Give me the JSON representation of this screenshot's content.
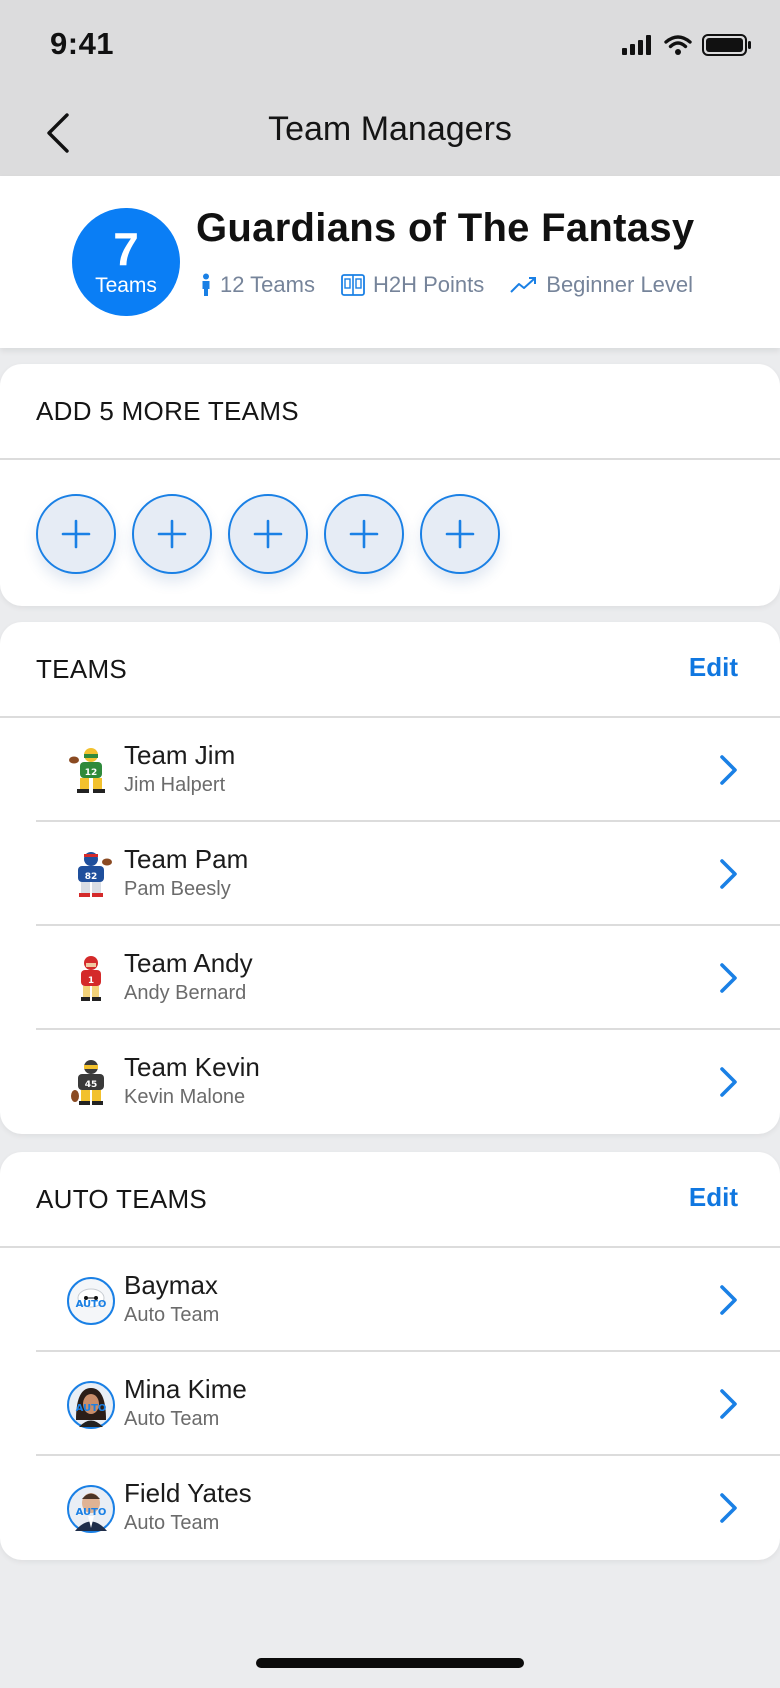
{
  "status_bar": {
    "time": "9:41",
    "icons": [
      "signal-icon",
      "wifi-icon",
      "battery-icon"
    ]
  },
  "nav": {
    "title": "Team Managers",
    "back_icon": "chevron-left-icon"
  },
  "league": {
    "team_count": "7",
    "team_count_label": "Teams",
    "name": "Guardians of The Fantasy",
    "meta": [
      {
        "icon": "person-icon",
        "label": "12 Teams"
      },
      {
        "icon": "scoreboard-icon",
        "label": "H2H Points"
      },
      {
        "icon": "trend-icon",
        "label": "Beginner Level"
      }
    ]
  },
  "add_teams": {
    "title": "ADD 5 MORE TEAMS",
    "slots": 5
  },
  "teams": {
    "title": "TEAMS",
    "edit_label": "Edit",
    "items": [
      {
        "name": "Team Jim",
        "owner": "Jim Halpert",
        "jersey": "12",
        "color": "#2f8a3b"
      },
      {
        "name": "Team Pam",
        "owner": "Pam Beesly",
        "jersey": "82",
        "color": "#1f4f9c"
      },
      {
        "name": "Team Andy",
        "owner": "Andy Bernard",
        "jersey": "1",
        "color": "#d42a2a"
      },
      {
        "name": "Team Kevin",
        "owner": "Kevin Malone",
        "jersey": "45",
        "color": "#3a3a3a"
      }
    ]
  },
  "auto_teams": {
    "title": "AUTO TEAMS",
    "edit_label": "Edit",
    "badge": "AUTO",
    "items": [
      {
        "name": "Baymax",
        "subtitle": "Auto Team"
      },
      {
        "name": "Mina Kime",
        "subtitle": "Auto Team"
      },
      {
        "name": "Field Yates",
        "subtitle": "Auto Team"
      }
    ]
  },
  "colors": {
    "accent": "#0a7ef5",
    "link": "#1077e0",
    "meta_text": "#76849a"
  }
}
